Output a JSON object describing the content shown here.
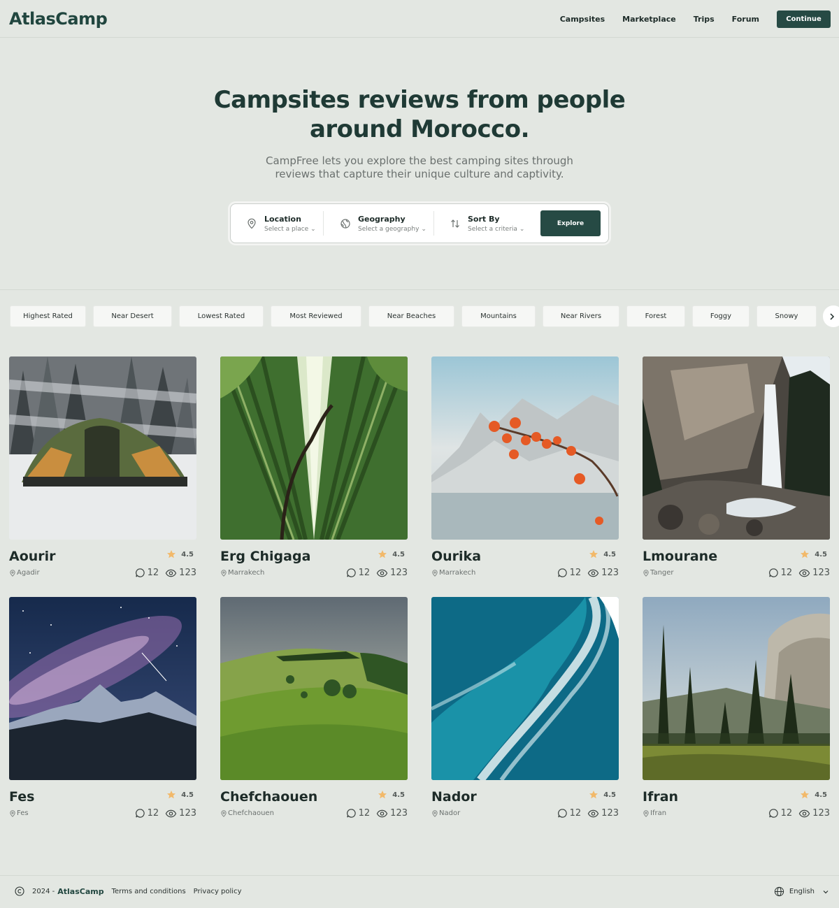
{
  "header": {
    "logo": "AtlasCamp",
    "nav": [
      "Campsites",
      "Marketplace",
      "Trips",
      "Forum"
    ],
    "continue_label": "Continue"
  },
  "hero": {
    "title_line1": "Campsites reviews from people",
    "title_line2": "around Morocco.",
    "subtitle": "CampFree lets you explore the best camping sites through reviews that capture their unique culture and captivity."
  },
  "search": {
    "location": {
      "label": "Location",
      "value": "Select a place"
    },
    "geography": {
      "label": "Geography",
      "value": "Select a geography"
    },
    "sort": {
      "label": "Sort By",
      "value": "Select a criteria"
    },
    "explore_label": "Explore"
  },
  "categories": [
    "Highest Rated",
    "Near Desert",
    "Lowest Rated",
    "Most Reviewed",
    "Near Beaches",
    "Mountains",
    "Near Rivers",
    "Forest",
    "Foggy",
    "Snowy"
  ],
  "cards": [
    {
      "name": "Aourir",
      "location": "Agadir",
      "rating": "4.5",
      "comments": "12",
      "views": "123",
      "image": "snow-tent"
    },
    {
      "name": "Erg Chigaga",
      "location": "Marrakech",
      "rating": "4.5",
      "comments": "12",
      "views": "123",
      "image": "bamboo-forest"
    },
    {
      "name": "Ourika",
      "location": "Marrakech",
      "rating": "4.5",
      "comments": "12",
      "views": "123",
      "image": "misty-lake-branch"
    },
    {
      "name": "Lmourane",
      "location": "Tanger",
      "rating": "4.5",
      "comments": "12",
      "views": "123",
      "image": "waterfall-cliff"
    },
    {
      "name": "Fes",
      "location": "Fes",
      "rating": "4.5",
      "comments": "12",
      "views": "123",
      "image": "milky-way-mountain"
    },
    {
      "name": "Chefchaouen",
      "location": "Chefchaouen",
      "rating": "4.5",
      "comments": "12",
      "views": "123",
      "image": "green-hills"
    },
    {
      "name": "Nador",
      "location": "Nador",
      "rating": "4.5",
      "comments": "12",
      "views": "123",
      "image": "ocean-waves"
    },
    {
      "name": "Ifran",
      "location": "Ifran",
      "rating": "4.5",
      "comments": "12",
      "views": "123",
      "image": "pine-valley"
    }
  ],
  "footer": {
    "year": "2024 -",
    "brand": "AtlasCamp",
    "terms": "Terms and conditions",
    "privacy": "Privacy policy",
    "language": "English"
  },
  "colors": {
    "accent": "#264a44",
    "star": "#f2b96a",
    "background": "#e3e7e2"
  }
}
